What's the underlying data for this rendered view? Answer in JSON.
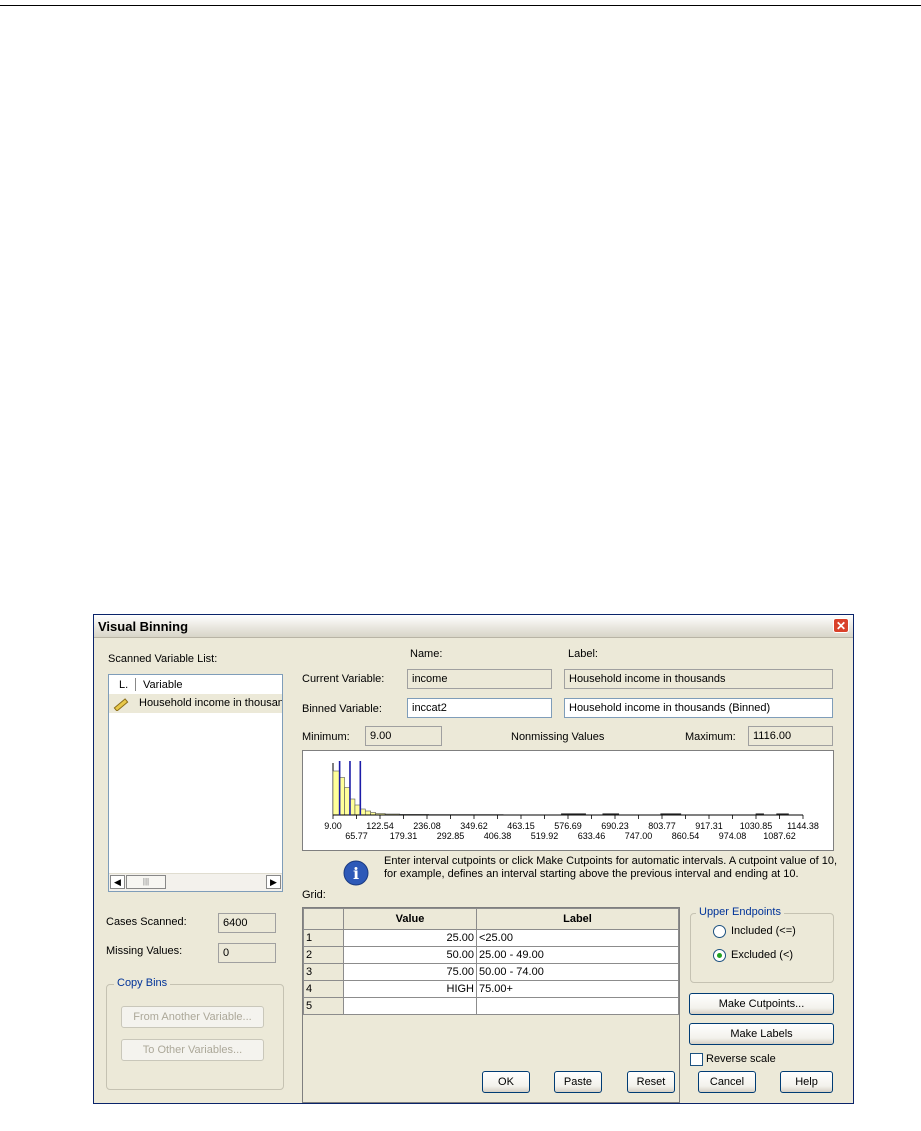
{
  "window": {
    "title": "Visual Binning"
  },
  "scanned_list": {
    "label": "Scanned Variable List:",
    "col_type": "L.",
    "col_variable": "Variable",
    "items": [
      "Household income in thousands"
    ]
  },
  "stats": {
    "cases_label": "Cases Scanned:",
    "cases_value": "6400",
    "missing_label": "Missing Values:",
    "missing_value": "0"
  },
  "copy_bins": {
    "title": "Copy Bins",
    "from_label": "From Another Variable...",
    "to_label": "To Other Variables..."
  },
  "variables": {
    "name_header": "Name:",
    "label_header": "Label:",
    "current_label": "Current Variable:",
    "current_name": "income",
    "current_var_label": "Household income in thousands",
    "binned_label": "Binned Variable:",
    "binned_name": "inccat2",
    "binned_var_label": "Household income in thousands (Binned)"
  },
  "range": {
    "minimum_label": "Minimum:",
    "minimum_value": "9.00",
    "nonmissing_label": "Nonmissing Values",
    "maximum_label": "Maximum:",
    "maximum_value": "1116.00"
  },
  "histogram": {
    "ticks_top": [
      "9.00",
      "122.54",
      "236.08",
      "349.62",
      "463.15",
      "576.69",
      "690.23",
      "803.77",
      "917.31",
      "1030.85",
      "1144.38"
    ],
    "ticks_bottom": [
      "65.77",
      "179.31",
      "292.85",
      "406.38",
      "519.92",
      "633.46",
      "747.00",
      "860.54",
      "974.08",
      "1087.62"
    ],
    "cutpoints": [
      25,
      50,
      75
    ],
    "colors": {
      "bar": "#ffff99",
      "cut": "#1c1ca8"
    }
  },
  "grid": {
    "label": "Grid:",
    "info": "Enter interval cutpoints or click Make Cutpoints for automatic intervals.  A cutpoint value of 10, for example, defines an interval starting above the previous interval and ending at 10.",
    "headers": [
      "Value",
      "Label"
    ],
    "rows": [
      {
        "num": "1",
        "value": "25.00",
        "label": "<25.00"
      },
      {
        "num": "2",
        "value": "50.00",
        "label": "25.00 - 49.00"
      },
      {
        "num": "3",
        "value": "75.00",
        "label": "50.00 - 74.00"
      },
      {
        "num": "4",
        "value": "HIGH",
        "label": "75.00+"
      },
      {
        "num": "5",
        "value": "",
        "label": ""
      }
    ]
  },
  "endpoints": {
    "title": "Upper Endpoints",
    "included": "Included (<=)",
    "excluded": "Excluded (<)",
    "selected": "excluded"
  },
  "actions": {
    "make_cutpoints": "Make Cutpoints...",
    "make_labels": "Make Labels",
    "reverse_scale": "Reverse scale"
  },
  "footer": {
    "ok": "OK",
    "paste": "Paste",
    "reset": "Reset",
    "cancel": "Cancel",
    "help": "Help"
  }
}
